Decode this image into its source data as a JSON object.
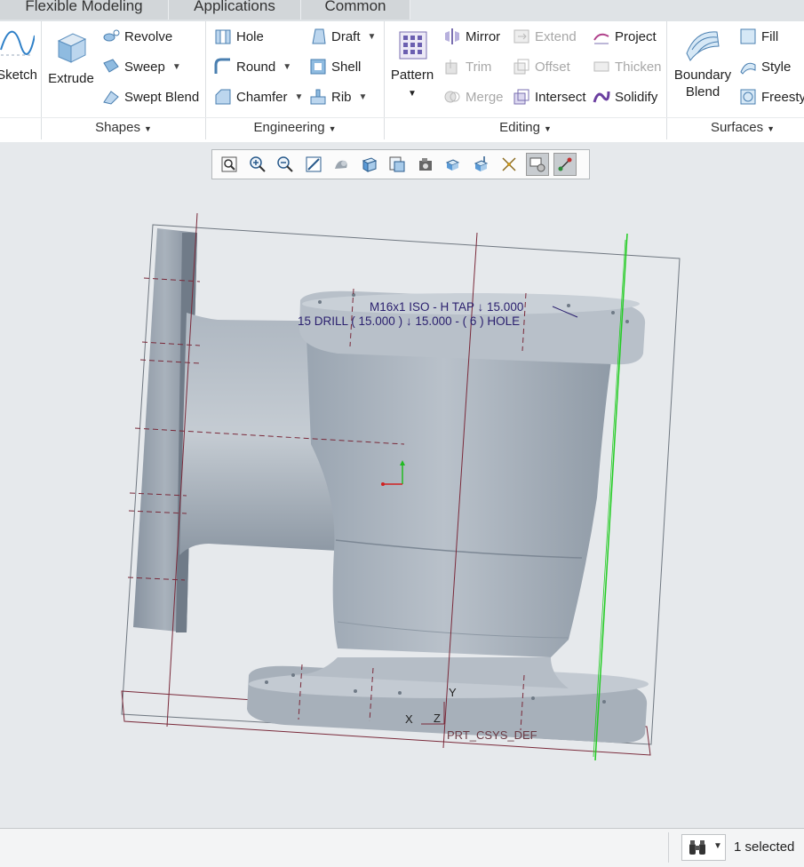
{
  "tabs": [
    "Flexible Modeling",
    "Applications",
    "Common"
  ],
  "ribbon": {
    "sketch": "Sketch",
    "extrude": "Extrude",
    "revolve": "Revolve",
    "sweep": "Sweep",
    "swept_blend": "Swept Blend",
    "hole": "Hole",
    "round": "Round",
    "chamfer": "Chamfer",
    "draft": "Draft",
    "shell": "Shell",
    "rib": "Rib",
    "pattern": "Pattern",
    "mirror": "Mirror",
    "trim": "Trim",
    "merge": "Merge",
    "extend": "Extend",
    "offset": "Offset",
    "intersect": "Intersect",
    "project": "Project",
    "thicken": "Thicken",
    "solidify": "Solidify",
    "boundary_blend_1": "Boundary",
    "boundary_blend_2": "Blend",
    "fill": "Fill",
    "style": "Style",
    "freestyle": "Freestyle",
    "groups": {
      "shapes": "Shapes",
      "engineering": "Engineering",
      "editing": "Editing",
      "surfaces": "Surfaces"
    }
  },
  "view_toolbar": [
    "refit-icon",
    "zoom-in-icon",
    "zoom-out-icon",
    "repaint-icon",
    "display-style-icon",
    "saved-orientations-icon",
    "view-manager-icon",
    "perspective-icon",
    "plane-display-icon",
    "axis-display-icon",
    "point-display-icon",
    "csys-display-icon",
    "annotation-display-icon"
  ],
  "annotation": {
    "line1": "M16x1 ISO - H TAP ↓ 15.000",
    "line2": "15 DRILL ( 15.000 ) ↓ 15.000 - ( 6 ) HOLE"
  },
  "csys": {
    "y": "Y",
    "x": "X",
    "z": "Z",
    "name": "PRT_CSYS_DEF"
  },
  "status": {
    "selected": "1 selected"
  },
  "colors": {
    "accent": "#2a5b8c",
    "model": "#aab3bd",
    "datum": "#7a2a3a",
    "selection": "#22cc22",
    "annotation": "#2a1f6e"
  }
}
